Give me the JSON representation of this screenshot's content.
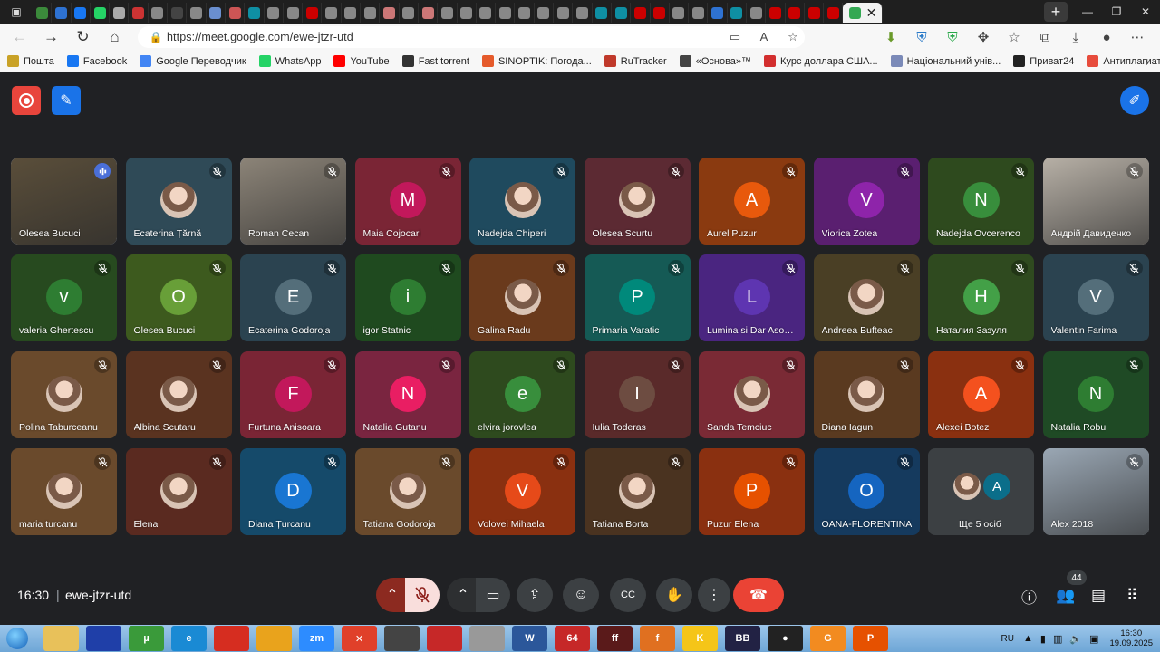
{
  "browser": {
    "url": "https://meet.google.com/ewe-jtzr-utd",
    "tab_colors": [
      "#3b8a3b",
      "#2e72d2",
      "#1877f2",
      "#25d366",
      "#aaaaaa",
      "#cc3333",
      "#888888",
      "#444444",
      "#888888",
      "#6a8fd0",
      "#cc5555",
      "#0f8fa3",
      "#888888",
      "#888888",
      "#cc0000",
      "#888888",
      "#888888",
      "#888888",
      "#cc7777",
      "#888888",
      "#cc7777",
      "#888888",
      "#888888",
      "#888888",
      "#888888",
      "#888888",
      "#888888",
      "#888888",
      "#888888",
      "#0f8fa3",
      "#0f8fa3",
      "#cc0000",
      "#cc0000",
      "#888888",
      "#888888",
      "#2e72d2",
      "#0f8fa3",
      "#888888",
      "#cc0000",
      "#cc0000",
      "#cc0000",
      "#cc0000"
    ],
    "bookmarks": [
      {
        "label": "Пошта",
        "color": "#c9a227",
        "icon": "mail-icon"
      },
      {
        "label": "Facebook",
        "color": "#1877f2",
        "icon": "facebook-icon"
      },
      {
        "label": "Google Переводчик",
        "color": "#4285f4",
        "icon": "translate-icon"
      },
      {
        "label": "WhatsApp",
        "color": "#25d366",
        "icon": "whatsapp-icon"
      },
      {
        "label": "YouTube",
        "color": "#ff0000",
        "icon": "youtube-icon"
      },
      {
        "label": "Fast torrent",
        "color": "#333333",
        "icon": "torrent-icon"
      },
      {
        "label": "SINOPTIK: Погода...",
        "color": "#e55a2b",
        "icon": "weather-icon"
      },
      {
        "label": "RuTracker",
        "color": "#c0392b",
        "icon": "rutracker-icon"
      },
      {
        "label": "«Основа»™",
        "color": "#444444",
        "icon": "osnova-icon"
      },
      {
        "label": "Курс доллара США...",
        "color": "#d32f2f",
        "icon": "currency-icon"
      },
      {
        "label": "Національний унів...",
        "color": "#7b8ab8",
        "icon": "university-icon"
      },
      {
        "label": "Приват24",
        "color": "#222222",
        "icon": "privat-icon"
      },
      {
        "label": "Антиплагиат Text.ru",
        "color": "#e74c3c",
        "icon": "antiplagiat-icon"
      }
    ]
  },
  "meeting": {
    "clock": "16:30",
    "separator": "|",
    "code": "ewe-jtzr-utd",
    "participants_count": "44",
    "more_label": "Ще 5 осіб",
    "more_avatar_letter": "A",
    "more_avatar_color": "#0b6e8a"
  },
  "tiles": [
    {
      "name": "Olesea Bucuci",
      "type": "video",
      "bg": "#5a4e3a",
      "mute": "speaking"
    },
    {
      "name": "Ecaterina Țărnă",
      "type": "photo",
      "bg": "#2f4a57",
      "mute": "muted"
    },
    {
      "name": "Roman Cecan",
      "type": "video",
      "bg": "#8c8478",
      "mute": "muted"
    },
    {
      "name": "Maia Cojocari",
      "letter": "M",
      "bg": "#7a2535",
      "avatar": "#c2185b",
      "mute": "muted"
    },
    {
      "name": "Nadejda Chiperi",
      "type": "photo",
      "bg": "#1f4a5e",
      "mute": "muted"
    },
    {
      "name": "Olesea Scurtu",
      "type": "photo",
      "bg": "#5c2a33",
      "mute": "muted"
    },
    {
      "name": "Aurel Puzur",
      "letter": "A",
      "bg": "#8a3a10",
      "avatar": "#e8590c",
      "mute": "muted"
    },
    {
      "name": "Viorica Zotea",
      "letter": "V",
      "bg": "#5a1f70",
      "avatar": "#8e24aa",
      "mute": "muted"
    },
    {
      "name": "Nadejda Ovcerenco",
      "letter": "N",
      "bg": "#2e4a1e",
      "avatar": "#388e3c",
      "mute": "muted"
    },
    {
      "name": "Андрій Давиденко",
      "type": "video",
      "bg": "#b7b0a6",
      "mute": "muted"
    },
    {
      "name": "valeria Ghertescu",
      "letter": "v",
      "bg": "#274a1f",
      "avatar": "#2e7d32",
      "mute": "muted"
    },
    {
      "name": "Olesea Bucuci",
      "letter": "O",
      "bg": "#3d5a1e",
      "avatar": "#689f38",
      "mute": "muted"
    },
    {
      "name": "Ecaterina Godoroja",
      "letter": "E",
      "bg": "#2b4350",
      "avatar": "#546e7a",
      "mute": "muted"
    },
    {
      "name": "igor Statnic",
      "letter": "i",
      "bg": "#1f4a1f",
      "avatar": "#2e7d32",
      "mute": "muted"
    },
    {
      "name": "Galina Radu",
      "type": "photo",
      "bg": "#6a3a1c",
      "mute": "muted"
    },
    {
      "name": "Primaria Varatic",
      "letter": "P",
      "bg": "#155a55",
      "avatar": "#00897b",
      "mute": "muted"
    },
    {
      "name": "Lumina si Dar Asociatia",
      "letter": "L",
      "bg": "#4a2580",
      "avatar": "#5e35b1",
      "mute": "muted"
    },
    {
      "name": "Andreea Bufteac",
      "type": "photo",
      "bg": "#4a3f25",
      "mute": "muted"
    },
    {
      "name": "Наталия Зазуля",
      "letter": "H",
      "bg": "#2f4a1f",
      "avatar": "#43a047",
      "mute": "muted"
    },
    {
      "name": "Valentin Farima",
      "letter": "V",
      "bg": "#2b4350",
      "avatar": "#546e7a",
      "mute": "muted"
    },
    {
      "name": "Polina Taburceanu",
      "type": "photo",
      "bg": "#6a4a2c",
      "mute": "muted"
    },
    {
      "name": "Albina Scutaru",
      "type": "photo",
      "bg": "#5a3320",
      "mute": "muted"
    },
    {
      "name": "Furtuna Anisoara",
      "letter": "F",
      "bg": "#7a2535",
      "avatar": "#c2185b",
      "mute": "muted"
    },
    {
      "name": "Natalia Gutanu",
      "letter": "N",
      "bg": "#7a2540",
      "avatar": "#e91e63",
      "mute": "muted"
    },
    {
      "name": "elvira jorovlea",
      "letter": "e",
      "bg": "#2e4a1e",
      "avatar": "#388e3c",
      "mute": "muted"
    },
    {
      "name": "Iulia Toderas",
      "letter": "I",
      "bg": "#5a2a2a",
      "avatar": "#6d4c41",
      "mute": "muted"
    },
    {
      "name": "Sanda Temciuc",
      "type": "photo",
      "bg": "#7a2a35",
      "mute": "muted"
    },
    {
      "name": "Diana Iagun",
      "type": "photo",
      "bg": "#5a3a20",
      "mute": "muted"
    },
    {
      "name": "Alexei Botez",
      "letter": "A",
      "bg": "#8a3010",
      "avatar": "#f4511e",
      "mute": "muted"
    },
    {
      "name": "Natalia Robu",
      "letter": "N",
      "bg": "#1f4a25",
      "avatar": "#2e7d32",
      "mute": "muted"
    },
    {
      "name": "maria turcanu",
      "type": "photo",
      "bg": "#6a4a2c",
      "mute": "muted"
    },
    {
      "name": "Elena",
      "type": "photo",
      "bg": "#5a2a20",
      "mute": "muted"
    },
    {
      "name": "Diana Țurcanu",
      "letter": "D",
      "bg": "#154a6a",
      "avatar": "#1976d2",
      "mute": "muted"
    },
    {
      "name": "Tatiana Godoroja",
      "type": "photo",
      "bg": "#6a4a2c",
      "mute": "muted"
    },
    {
      "name": "Volovei Mihaela",
      "letter": "V",
      "bg": "#8a3010",
      "avatar": "#e64a19",
      "mute": "muted"
    },
    {
      "name": "Tatiana Borta",
      "type": "photo",
      "bg": "#4a3320",
      "mute": "muted"
    },
    {
      "name": "Puzur Elena",
      "letter": "P",
      "bg": "#8a3010",
      "avatar": "#e65100",
      "mute": "muted"
    },
    {
      "name": "OANA-FLORENTINA",
      "letter": "O",
      "bg": "#153a5e",
      "avatar": "#1565c0",
      "mute": "muted"
    },
    {
      "name": "Ще 5 осіб",
      "type": "more",
      "bg": "#3c4043"
    },
    {
      "name": "Alex 2018",
      "type": "video",
      "bg": "#9aa7b4",
      "mute": "muted"
    }
  ],
  "taskbar": {
    "language": "RU",
    "time": "16:30",
    "date": "19.09.2025",
    "apps": [
      {
        "name": "explorer",
        "color": "#e8c15a",
        "label": ""
      },
      {
        "name": "save",
        "color": "#1f3fa8",
        "label": ""
      },
      {
        "name": "utorrent",
        "color": "#3a9a3a",
        "label": "µ"
      },
      {
        "name": "edge",
        "color": "#1a8ad4",
        "label": "e"
      },
      {
        "name": "red-app",
        "color": "#d62d20",
        "label": ""
      },
      {
        "name": "yellow-app",
        "color": "#e9a31c",
        "label": ""
      },
      {
        "name": "zoom",
        "color": "#2d8cff",
        "label": "zm"
      },
      {
        "name": "x-app",
        "color": "#e0402a",
        "label": "✕"
      },
      {
        "name": "keyboard-app",
        "color": "#444444",
        "label": ""
      },
      {
        "name": "pdf",
        "color": "#c62828",
        "label": ""
      },
      {
        "name": "tools-app",
        "color": "#999999",
        "label": ""
      },
      {
        "name": "word",
        "color": "#2b579a",
        "label": "W"
      },
      {
        "name": "64-app",
        "color": "#c62828",
        "label": "64"
      },
      {
        "name": "ff-app",
        "color": "#5a1a1a",
        "label": "ff"
      },
      {
        "name": "f-app",
        "color": "#e07020",
        "label": "f"
      },
      {
        "name": "k-app",
        "color": "#f5c518",
        "label": "K"
      },
      {
        "name": "bb-app",
        "color": "#222244",
        "label": "BB"
      },
      {
        "name": "rec-app",
        "color": "#222222",
        "label": "●"
      },
      {
        "name": "g-app",
        "color": "#f28b20",
        "label": "G"
      },
      {
        "name": "p-app",
        "color": "#e65100",
        "label": "P"
      }
    ]
  }
}
